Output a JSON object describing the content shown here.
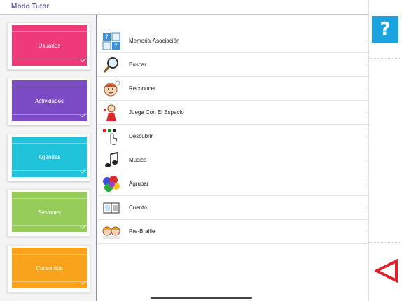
{
  "app": {
    "title": "Modo Tutor"
  },
  "sidebar": {
    "cards": [
      {
        "label": "Usuarios",
        "color": "#ee3a78"
      },
      {
        "label": "Actividades",
        "color": "#7b4bc6"
      },
      {
        "label": "Agendas",
        "color": "#21c3da"
      },
      {
        "label": "Sesiones",
        "color": "#96cc5a"
      },
      {
        "label": "Conceptos",
        "color": "#f9a21b"
      }
    ]
  },
  "activities": {
    "items": [
      {
        "label": "Memoria-Asociación",
        "icon": "memory-icon"
      },
      {
        "label": "Buscar",
        "icon": "magnifier-icon"
      },
      {
        "label": "Reconocer",
        "icon": "face-icon"
      },
      {
        "label": "Juega Con El Espacio",
        "icon": "child-icon"
      },
      {
        "label": "Descubrir",
        "icon": "hand-pointer-icon"
      },
      {
        "label": "Música",
        "icon": "music-notes-icon"
      },
      {
        "label": "Agrupar",
        "icon": "color-blobs-icon"
      },
      {
        "label": "Cuento",
        "icon": "book-icon"
      },
      {
        "label": "Pre-Braille",
        "icon": "braille-faces-icon"
      }
    ],
    "chevron": "›"
  },
  "toolbar": {
    "help_label": "?"
  },
  "colors": {
    "help": "#1aa3df",
    "back": "#e0202c",
    "title": "#6a5fa8"
  }
}
